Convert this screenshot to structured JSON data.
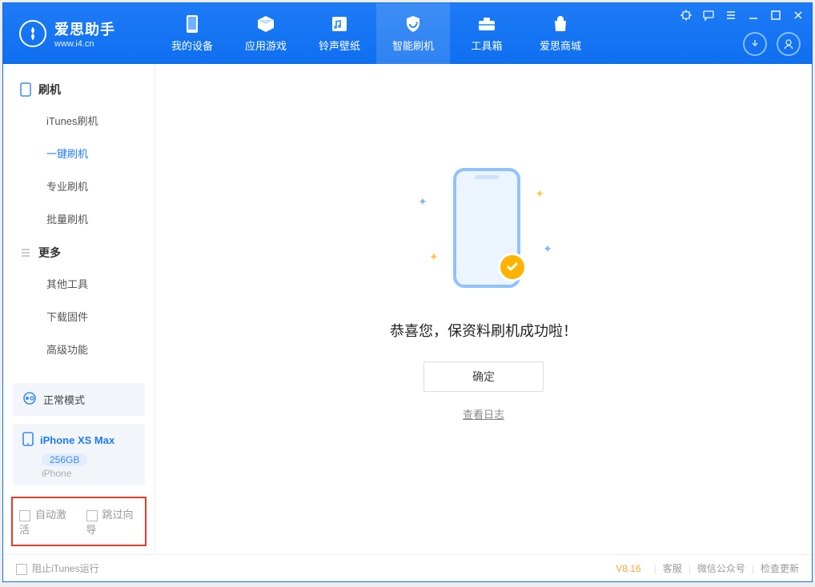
{
  "brand": {
    "name": "爱思助手",
    "url": "www.i4.cn"
  },
  "nav": {
    "my_device": "我的设备",
    "apps_games": "应用游戏",
    "ring_wall": "铃声壁纸",
    "smart_flash": "智能刷机",
    "toolbox": "工具箱",
    "store": "爱思商城"
  },
  "sidebar": {
    "section_flash": "刷机",
    "items_flash": [
      "iTunes刷机",
      "一键刷机",
      "专业刷机",
      "批量刷机"
    ],
    "section_more": "更多",
    "items_more": [
      "其他工具",
      "下载固件",
      "高级功能"
    ]
  },
  "mode": {
    "label": "正常模式"
  },
  "device": {
    "name": "iPhone XS Max",
    "capacity": "256GB",
    "type": "iPhone"
  },
  "options": {
    "auto_activate": "自动激活",
    "skip_wizard": "跳过向导"
  },
  "main": {
    "success": "恭喜您，保资料刷机成功啦！",
    "ok": "确定",
    "view_log": "查看日志"
  },
  "status": {
    "block_itunes": "阻止iTunes运行",
    "version": "V8.16",
    "support": "客服",
    "wechat": "微信公众号",
    "update": "检查更新"
  }
}
